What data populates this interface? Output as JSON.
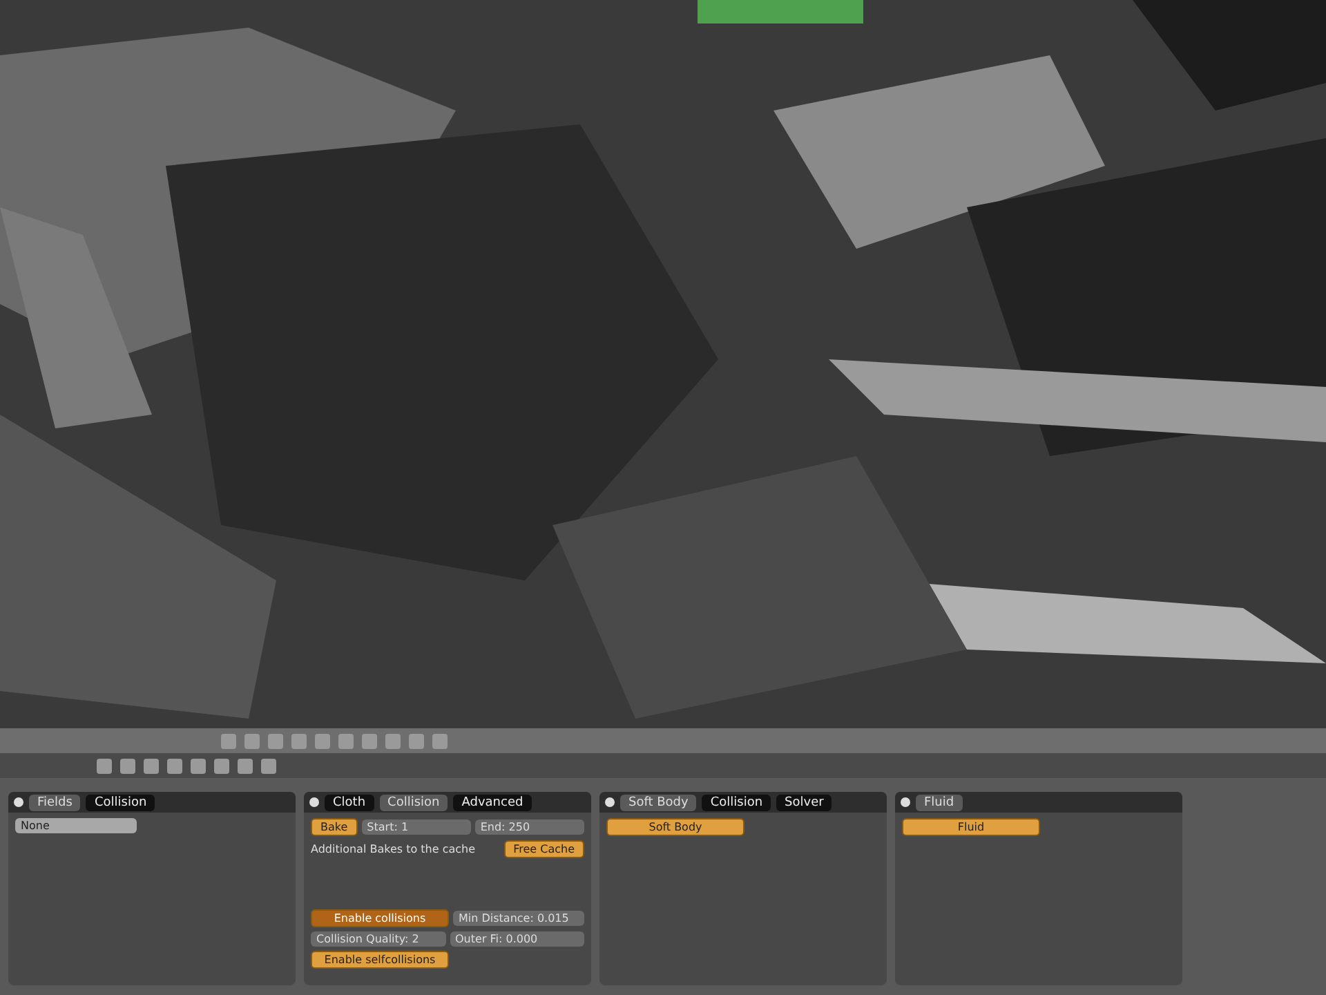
{
  "panels": [
    {
      "tabs": [
        {
          "label": "Fields",
          "selected": true
        },
        {
          "label": "Collision",
          "selected": false
        }
      ],
      "rows": [
        {
          "items": [
            {
              "kind": "dropdown",
              "label": "None"
            }
          ]
        }
      ]
    },
    {
      "tabs": [
        {
          "label": "Cloth",
          "selected": false
        },
        {
          "label": "Collision",
          "selected": true
        },
        {
          "label": "Advanced",
          "selected": false
        }
      ],
      "rows": [
        {
          "items": [
            {
              "kind": "button",
              "label": "Bake"
            },
            {
              "kind": "number",
              "label": "Start: 1"
            },
            {
              "kind": "number",
              "label": "End: 250"
            }
          ]
        },
        {
          "items": [
            {
              "kind": "label",
              "label": "Additional Bakes to the cache"
            },
            {
              "kind": "button",
              "label": "Free Cache"
            }
          ]
        },
        {
          "items": [
            {
              "kind": "toggle",
              "label": "Enable collisions",
              "on": true
            },
            {
              "kind": "number",
              "label": "Min Distance: 0.015"
            }
          ]
        },
        {
          "items": [
            {
              "kind": "number",
              "label": "Collision Quality: 2"
            },
            {
              "kind": "number",
              "label": "Outer Fi: 0.000"
            }
          ]
        },
        {
          "items": [
            {
              "kind": "toggle",
              "label": "Enable selfcollisions",
              "on": false
            }
          ]
        }
      ]
    },
    {
      "tabs": [
        {
          "label": "Soft Body",
          "selected": true
        },
        {
          "label": "Collision",
          "selected": false
        },
        {
          "label": "Solver",
          "selected": false
        }
      ],
      "rows": [
        {
          "items": [
            {
              "kind": "toggle",
              "label": "Soft Body",
              "on": false
            }
          ]
        }
      ]
    },
    {
      "tabs": [
        {
          "label": "Fluid",
          "selected": true
        }
      ],
      "rows": [
        {
          "items": [
            {
              "kind": "toggle",
              "label": "Fluid",
              "on": false
            }
          ]
        }
      ]
    }
  ]
}
